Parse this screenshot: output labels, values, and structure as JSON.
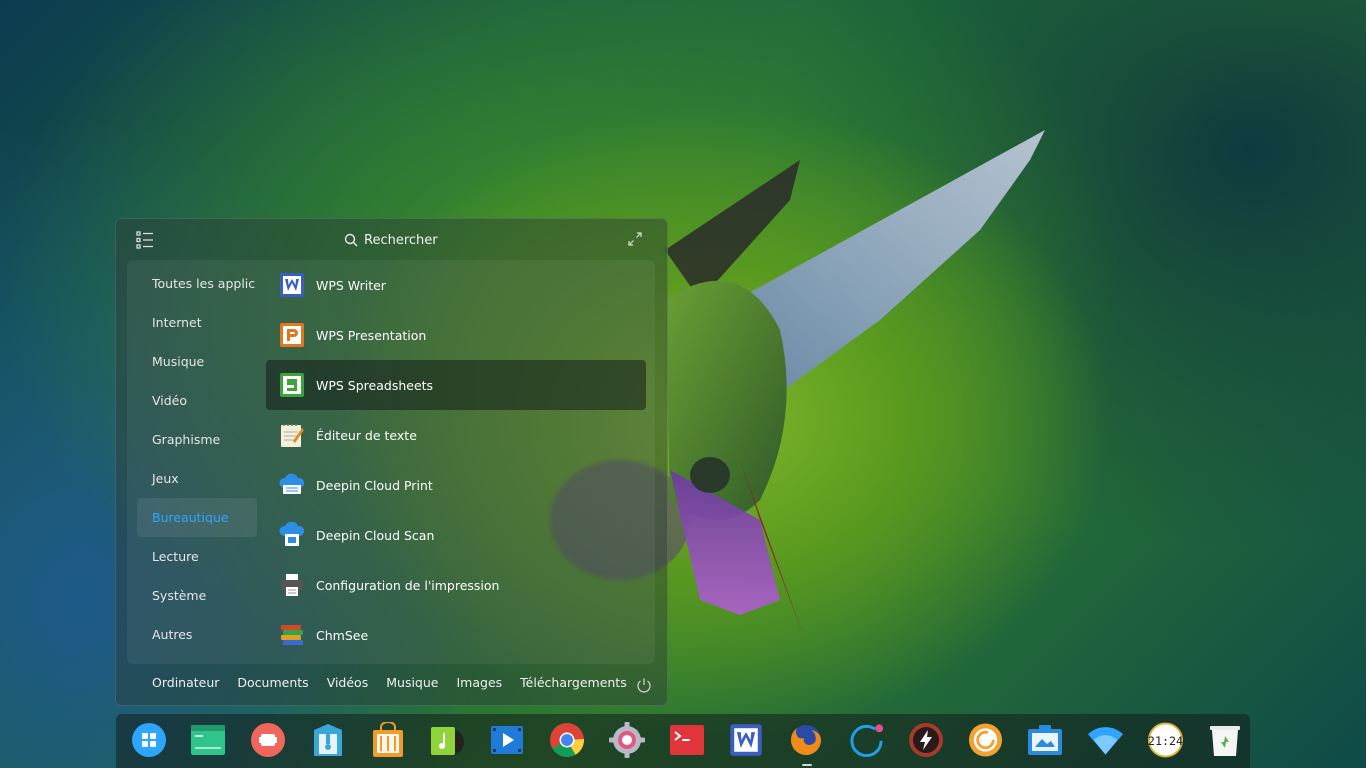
{
  "launcher": {
    "search_label": "Rechercher",
    "categories": [
      {
        "label": "Toutes les applic",
        "active": false
      },
      {
        "label": "Internet",
        "active": false
      },
      {
        "label": "Musique",
        "active": false
      },
      {
        "label": "Vidéo",
        "active": false
      },
      {
        "label": "Graphisme",
        "active": false
      },
      {
        "label": "Jeux",
        "active": false
      },
      {
        "label": "Bureautique",
        "active": true
      },
      {
        "label": "Lecture",
        "active": false
      },
      {
        "label": "Système",
        "active": false
      },
      {
        "label": "Autres",
        "active": false
      }
    ],
    "apps": [
      {
        "label": "WPS Writer",
        "icon": "wps-writer-icon"
      },
      {
        "label": "WPS Presentation",
        "icon": "wps-presentation-icon"
      },
      {
        "label": "WPS Spreadsheets",
        "icon": "wps-spreadsheets-icon",
        "selected": true
      },
      {
        "label": "Éditeur de texte",
        "icon": "text-editor-icon"
      },
      {
        "label": "Deepin Cloud Print",
        "icon": "cloud-print-icon"
      },
      {
        "label": "Deepin Cloud Scan",
        "icon": "cloud-scan-icon"
      },
      {
        "label": "Configuration de l'impression",
        "icon": "printer-icon"
      },
      {
        "label": "ChmSee",
        "icon": "chmsee-icon"
      }
    ],
    "places": [
      "Ordinateur",
      "Documents",
      "Vidéos",
      "Musique",
      "Images",
      "Téléchargements"
    ]
  },
  "dock": {
    "items": [
      "launcher-icon",
      "file-manager-icon",
      "screen-recorder-icon",
      "archive-manager-icon",
      "app-store-icon",
      "music-icon",
      "movie-icon",
      "chrome-icon",
      "settings-icon",
      "terminal-icon",
      "wps-writer-icon",
      "firefox-icon",
      "deepin-circle-icon",
      "boot-maker-icon",
      "camera-icon",
      "screenshot-icon",
      "wifi-icon",
      "clock-icon",
      "trash-icon"
    ],
    "clock_text": "21:24"
  },
  "colors": {
    "accent": "#2ea6ff",
    "wps_writer": "#3b5fc0",
    "wps_presentation": "#e2771f",
    "wps_spreadsheets": "#3ea33b"
  }
}
